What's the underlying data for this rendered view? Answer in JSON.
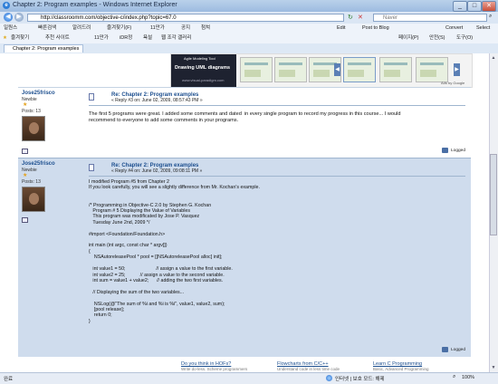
{
  "window": {
    "title": "Chapter 2: Program examples - Windows Internet Explorer",
    "btn_min": "_",
    "btn_max": "□",
    "btn_close": "✕"
  },
  "address": {
    "url": "http://classroomm.com/objective-c/index.php?topic=67.0",
    "search_placeholder": "Naver"
  },
  "toolbar1": {
    "items": [
      "일원스",
      "빠른검색",
      "알려드려",
      "즐겨찾기(F)",
      "11만가",
      "공지",
      "첨쳐"
    ],
    "right": [
      "Edit",
      "Post to Blog",
      "Convert",
      "Select"
    ]
  },
  "toolbar2": {
    "items": [
      "즐겨찾기",
      "추천 사이트",
      "11만가",
      "iDR정",
      "욕설",
      "웹 조각 갤러리"
    ],
    "right": [
      "페이지(P)",
      "안전(S)",
      "도구(O)"
    ]
  },
  "tab": {
    "label": "Chapter 2: Program examples"
  },
  "ad": {
    "line1": "Agile Modeling Tool",
    "line2": "Drawing UML diagrams",
    "line3": "www.visual-paradigm.com",
    "google": "Ads by Google"
  },
  "post1": {
    "author": "Jose25frisco",
    "rank": "Newbie",
    "posts": "Posts: 13",
    "title": "Re: Chapter 2: Program examples",
    "meta": "« Reply #3 on: June 02, 2009, 08:57:43 PM »",
    "body": "The first 5 programs were great. I added some comments and dated  in every single program to record my progress in this course... I would\nrecommend to everyone to add some comments in your programs.",
    "logged": "Logged"
  },
  "post2": {
    "author": "Jose25frisco",
    "rank": "Newbie",
    "posts": "Posts: 13",
    "title": "Re: Chapter 2: Program examples",
    "meta": "« Reply #4 on: June 02, 2009, 09:08:11 PM »",
    "body": "I modified Program #5 from Chapter 2\nIf you look carefully, you will see a slightly difference from Mr. Kochan's example.\n\n\n/* Programming in Objective-C 2.0 by Stephen G. Kochan\n   Program # 5 Displaying the Value of Variables\n   This program was modificated by Jose P. Vasquez\n   Tuesday June 2nd, 2009 */\n\n#import <Foundation/Foundation.h>\n\nint main (int argc, const char * argv[])\n{\n    NSAutoreleasePool * pool = [[NSAutoreleasePool alloc] init];\n\n   int value1 = 50;                       // assign a value to the first variable.\n   int value2 = 25;           // assign a value to the second variable.\n   int sum = value1 + value2;      // adding the two first variables.\n\n   // Displaying the sum of the two variables...\n\n    NSLog(@\"The sum of %i and %i is %i\", value1, value2, sum);\n    [pool release];\n    return 0;\n}",
    "logged": "Logged"
  },
  "bottom_links": [
    {
      "title": "Do you think in HOFs?",
      "sub": "Write do-less. Scheme programmers"
    },
    {
      "title": "Flowcharts from C/C++",
      "sub": "Understand code in less time code"
    },
    {
      "title": "Learn C Programming",
      "sub": "Basic, Advanced Programming"
    }
  ],
  "status": {
    "left": "완료",
    "zone": "인터넷 | 보호 모드: 해제",
    "zoom": "100%"
  }
}
